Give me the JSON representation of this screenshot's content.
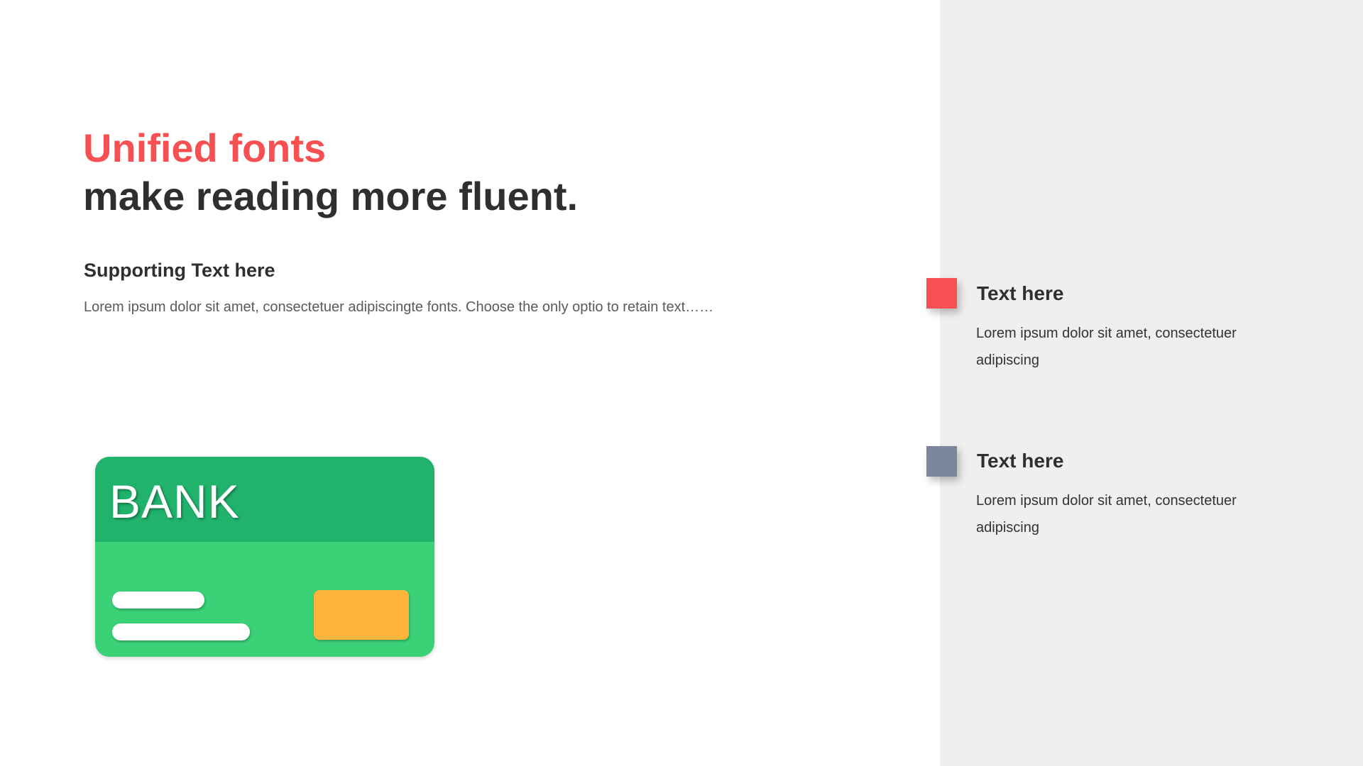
{
  "headline": {
    "accent": "Unified fonts",
    "main": "make reading more fluent."
  },
  "supporting": {
    "title": "Supporting Text here",
    "body": "Lorem ipsum dolor sit amet, consectetuer adipiscingte fonts. Choose the only optio to retain text……"
  },
  "card": {
    "label": "BANK",
    "icon": "bank-card-icon"
  },
  "items": [
    {
      "title": "Text here",
      "desc": "Lorem ipsum dolor sit amet, consectetuer adipiscing",
      "color": "#f75052"
    },
    {
      "title": "Text here",
      "desc": "Lorem ipsum dolor sit amet, consectetuer adipiscing",
      "color": "#7a8699"
    }
  ],
  "colors": {
    "accent": "#f75052",
    "heading": "#2f2f2f",
    "body": "#5a5a5a",
    "panel": "#efefef",
    "card_dark": "#21b36c",
    "card_light": "#3ad177",
    "chip": "#fdb43a"
  }
}
